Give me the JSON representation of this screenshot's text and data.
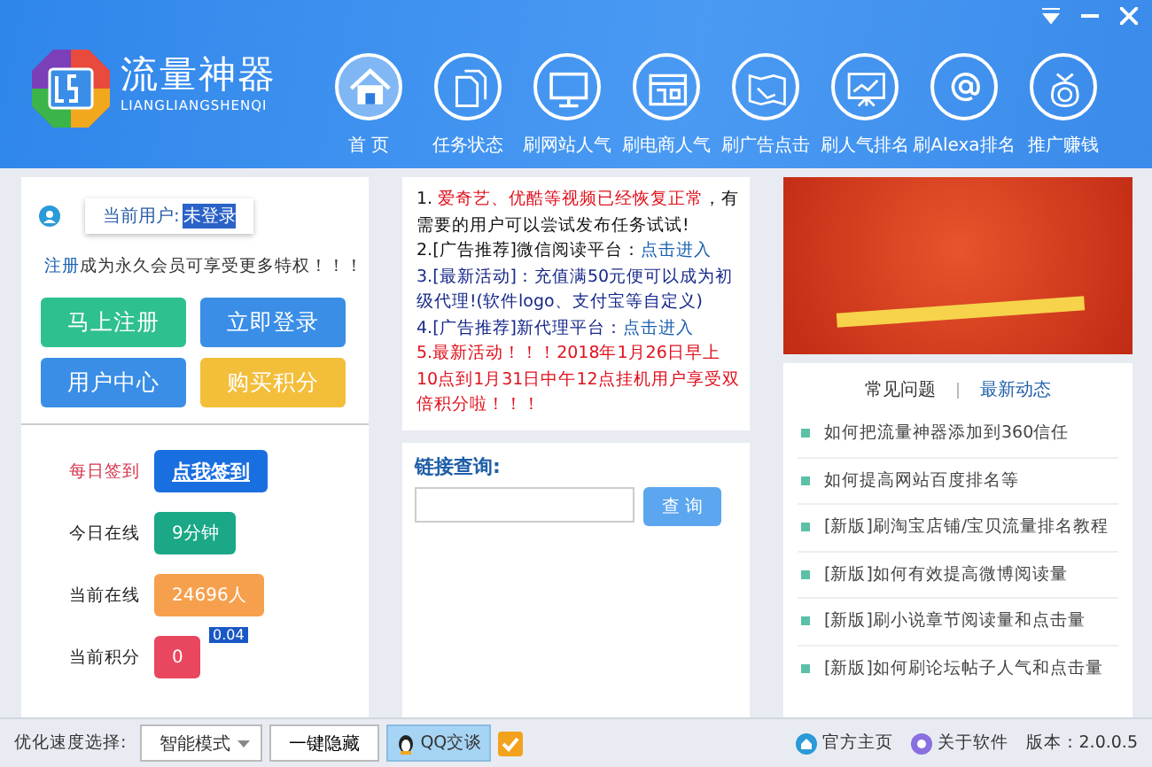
{
  "window": {
    "title": "流量神器",
    "subtitle": "LIANGLIANGSHENQI"
  },
  "nav": [
    {
      "label": "首 页",
      "selected": true
    },
    {
      "label": "任务状态",
      "selected": false
    },
    {
      "label": "刷网站人气",
      "selected": false
    },
    {
      "label": "刷电商人气",
      "selected": false
    },
    {
      "label": "刷广告点击",
      "selected": false
    },
    {
      "label": "刷人气排名",
      "selected": false
    },
    {
      "label": "刷Alexa排名",
      "selected": false
    },
    {
      "label": "推广赚钱",
      "selected": false
    }
  ],
  "user": {
    "label": "当前用户:",
    "value": "未登录",
    "promo_link": "注册",
    "promo_text": "成为永久会员可享受更多特权！！！"
  },
  "account_buttons": [
    {
      "label": "马上注册",
      "color": "#2ec08e"
    },
    {
      "label": "立即登录",
      "color": "#3a8ee6"
    },
    {
      "label": "用户中心",
      "color": "#3a8ee6"
    },
    {
      "label": "购买积分",
      "color": "#f3be3a"
    }
  ],
  "stats": [
    {
      "label": "每日签到",
      "kind": "action",
      "value": "点我签到",
      "color": "#1a6fe0"
    },
    {
      "label": "今日在线",
      "kind": "badge",
      "value": "9分钟",
      "color": "#1aa886"
    },
    {
      "label": "当前在线",
      "kind": "badge",
      "value": "24696人",
      "color": "#f6a04d"
    },
    {
      "label": "当前积分",
      "kind": "badge",
      "value": "0",
      "color": "#e8475f",
      "tooltip": "0.04"
    }
  ],
  "notices": [
    {
      "segments": [
        {
          "kind": "normal",
          "text": "1. "
        },
        {
          "kind": "alert",
          "text": "爱奇艺、优酷等视频已经恢复正常"
        },
        {
          "kind": "normal",
          "text": "，有需要的用户可以尝试发布任务试试!"
        }
      ]
    },
    {
      "segments": [
        {
          "kind": "normal",
          "text": "2.[广告推荐]微信阅读平台："
        },
        {
          "kind": "link",
          "text": "点击进入"
        }
      ]
    },
    {
      "segments": [
        {
          "kind": "info",
          "text": "3.[最新活动]：充值满50元便可以成为初级代理!(软件logo、支付宝等自定义)"
        }
      ]
    },
    {
      "segments": [
        {
          "kind": "info",
          "text": "4.[广告推荐]新代理平台："
        },
        {
          "kind": "link",
          "text": "点击进入"
        }
      ]
    },
    {
      "segments": [
        {
          "kind": "alert",
          "text": "5.最新活动！！！2018年1月26日早上10点到1月31日中午12点挂机用户享受双倍积分啦！！！"
        }
      ]
    }
  ],
  "query": {
    "label": "链接查询:",
    "button": "查 询"
  },
  "help_tabs": [
    {
      "label": "常见问题",
      "selected": false
    },
    {
      "label": "最新动态",
      "selected": true
    }
  ],
  "articles": [
    "如何把流量神器添加到360信任",
    "如何提高网站百度排名等",
    "[新版]刷淘宝店铺/宝贝流量排名教程",
    "[新版]如何有效提高微博阅读量",
    "[新版]刷小说章节阅读量和点击量",
    "[新版]如何刷论坛帖子人气和点击量"
  ],
  "status_bar": {
    "speed_label": "优化速度选择:",
    "speed_mode": "智能模式",
    "hide_button": "一键隐藏",
    "qq_button": "QQ交谈",
    "home_link": "官方主页",
    "about_link": "关于软件",
    "version": "版本：2.0.0.5"
  }
}
